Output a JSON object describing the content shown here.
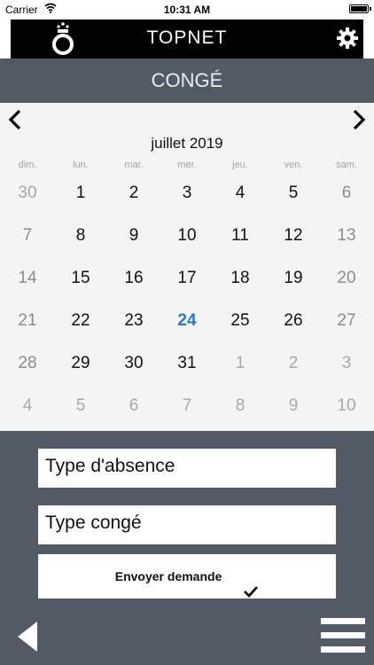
{
  "status": {
    "carrier": "Carrier",
    "time": "10:31 AM",
    "wifi_icon": "wifi-icon",
    "battery_icon": "battery-icon"
  },
  "header": {
    "title": "TOPNET",
    "logo_icon": "crown-logo-icon",
    "settings_icon": "gear-icon"
  },
  "subheader": {
    "title": "CONGÉ"
  },
  "calendar": {
    "month_title": "juillet 2019",
    "prev_icon": "chevron-left-icon",
    "next_icon": "chevron-right-icon",
    "weekdays": [
      "dim.",
      "lun.",
      "mar.",
      "mer.",
      "jeu.",
      "ven.",
      "sam."
    ],
    "weeks": [
      [
        "30",
        "1",
        "2",
        "3",
        "4",
        "5",
        "6"
      ],
      [
        "7",
        "8",
        "9",
        "10",
        "11",
        "12",
        "13"
      ],
      [
        "14",
        "15",
        "16",
        "17",
        "18",
        "19",
        "20"
      ],
      [
        "21",
        "22",
        "23",
        "24",
        "25",
        "26",
        "27"
      ],
      [
        "28",
        "29",
        "30",
        "31",
        "1",
        "2",
        "3"
      ],
      [
        "4",
        "5",
        "6",
        "7",
        "8",
        "9",
        "10"
      ]
    ],
    "today": "24",
    "colors": {
      "today": "#1f7bd8"
    }
  },
  "form": {
    "absence_type": "Type d'absence",
    "leave_type": "Type congé",
    "submit_label": "Envoyer demande",
    "submit_icon": "checkmark-icon"
  },
  "footer": {
    "back_icon": "back-triangle-icon",
    "menu_icon": "hamburger-menu-icon"
  }
}
